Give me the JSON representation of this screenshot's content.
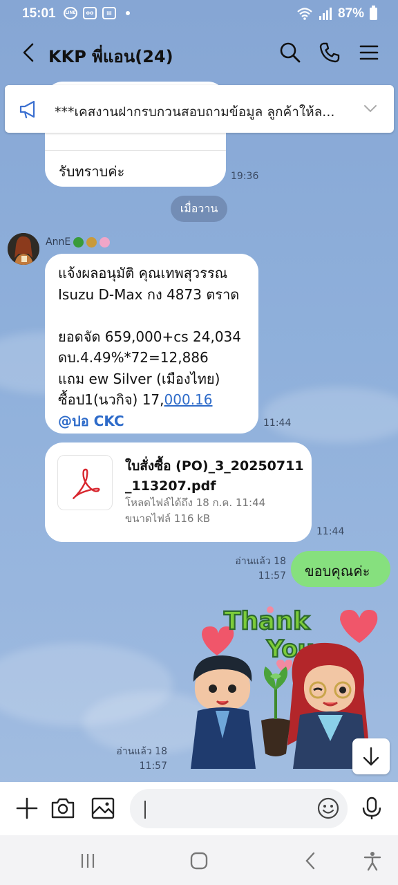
{
  "status_bar": {
    "time": "15:01",
    "battery": "87%",
    "app_icons": [
      "LINE",
      "oo",
      "▤"
    ]
  },
  "header": {
    "title": "KKP พี่แอน(24)",
    "icons": [
      "back-icon",
      "search-icon",
      "phone-icon",
      "menu-icon"
    ]
  },
  "announcement": {
    "text": "***เคสงานฝากรบกวนสอบถามข้อมูล ลูกค้าให้ล..."
  },
  "messages": {
    "first": {
      "quote_line": "...ค่ะ",
      "reply": "รับทราบค่ะ",
      "time": "19:36"
    },
    "date_divider": "เมื่อวาน",
    "sender_name": "AnnE",
    "main": {
      "lines": [
        "แจ้งผลอนุมัติ คุณเทพสุวรรณ",
        "Isuzu D-Max กง 4873 ตราด",
        "",
        "ยอดจัด 659,000+cs 24,034",
        "ดบ.4.49%*72=12,886",
        "แถม ew Silver (เมืองไทย)"
      ],
      "last_line_prefix": "ซื้อป1(นวกิจ) 17,",
      "last_line_link": "000.16",
      "mention": "@ปอ CKC",
      "time": "11:44"
    },
    "file": {
      "name": "ใบสั่งซื้อ (PO)_3_20250711_113207.pdf",
      "name_line1": "ใบสั่งซื้อ (PO)_3_20250711",
      "name_line2": "_113207.pdf",
      "download_until": "โหลดไฟล์ได้ถึง 18 ก.ค. 11:44",
      "size": "ขนาดไฟล์ 116 kB",
      "time": "11:44"
    },
    "mine_text": {
      "text": "ขอบคุณค่ะ",
      "read": "อ่านแล้ว 18",
      "time": "11:57"
    },
    "mine_sticker": {
      "sticker_text_1": "Thank",
      "sticker_text_2": "You",
      "read": "อ่านแล้ว 18",
      "time": "11:57"
    }
  },
  "input": {
    "placeholder": ""
  },
  "colors": {
    "background": "#8fadd7",
    "my_bubble": "#86e07e",
    "link": "#2e6bc9"
  }
}
